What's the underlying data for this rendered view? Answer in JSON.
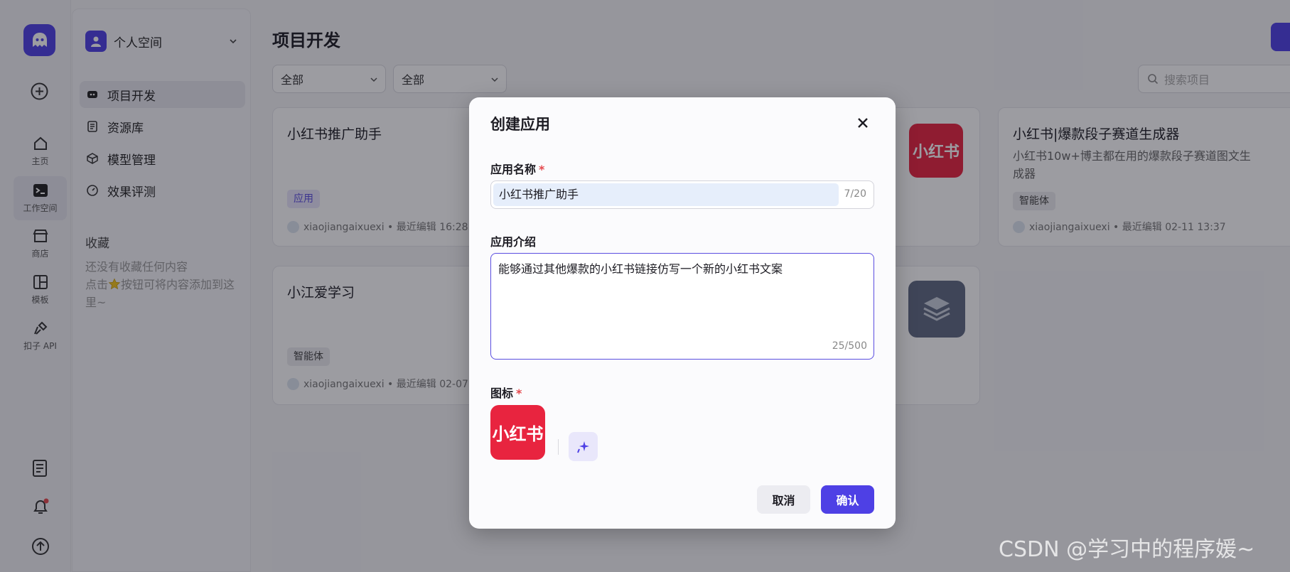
{
  "rail": {
    "items": [
      {
        "label": "主页"
      },
      {
        "label": "工作空间"
      },
      {
        "label": "商店"
      },
      {
        "label": "模板"
      },
      {
        "label": "扣子 API"
      }
    ]
  },
  "sidebar": {
    "space_label": "个人空间",
    "menu": [
      {
        "label": "项目开发"
      },
      {
        "label": "资源库"
      },
      {
        "label": "模型管理"
      },
      {
        "label": "效果评测"
      }
    ],
    "favorites_title": "收藏",
    "favorites_hint_1": "还没有收藏任何内容",
    "favorites_hint_2": "点击",
    "favorites_hint_3": "按钮可将内容添加到这里~"
  },
  "main": {
    "title": "项目开发",
    "filter1": "全部",
    "filter2": "全部",
    "search_placeholder": "搜索项目",
    "cards": [
      {
        "title": "小红书推广助手",
        "tag": "应用",
        "meta": "xiaojiangaixuexi • 最近编辑 16:28"
      },
      {
        "title": "小红书|爆款段子赛道生成器",
        "desc": "小红书10w+博主都在用的爆款段子赛道图文生成器",
        "tag": "智能体",
        "meta": "xiaojiangaixuexi • 最近编辑 02-11 13:37"
      },
      {
        "title": "小江爱学习",
        "tag": "智能体",
        "meta": "xiaojiangaixuexi • 最近编辑 02-07"
      }
    ],
    "thumb_text": "小红书"
  },
  "modal": {
    "title": "创建应用",
    "name_label": "应用名称",
    "name_value": "小红书推广助手",
    "name_count": "7/20",
    "desc_label": "应用介绍",
    "desc_value": "能够通过其他爆款的小红书链接仿写一个新的小红书文案",
    "desc_count": "25/500",
    "icon_label": "图标",
    "icon_text": "小红书",
    "cancel_label": "取消",
    "confirm_label": "确认",
    "required_mark": "*"
  },
  "watermark": "CSDN @学习中的程序媛~",
  "colors": {
    "accent": "#4e40e5",
    "brand_red": "#e8243f"
  }
}
